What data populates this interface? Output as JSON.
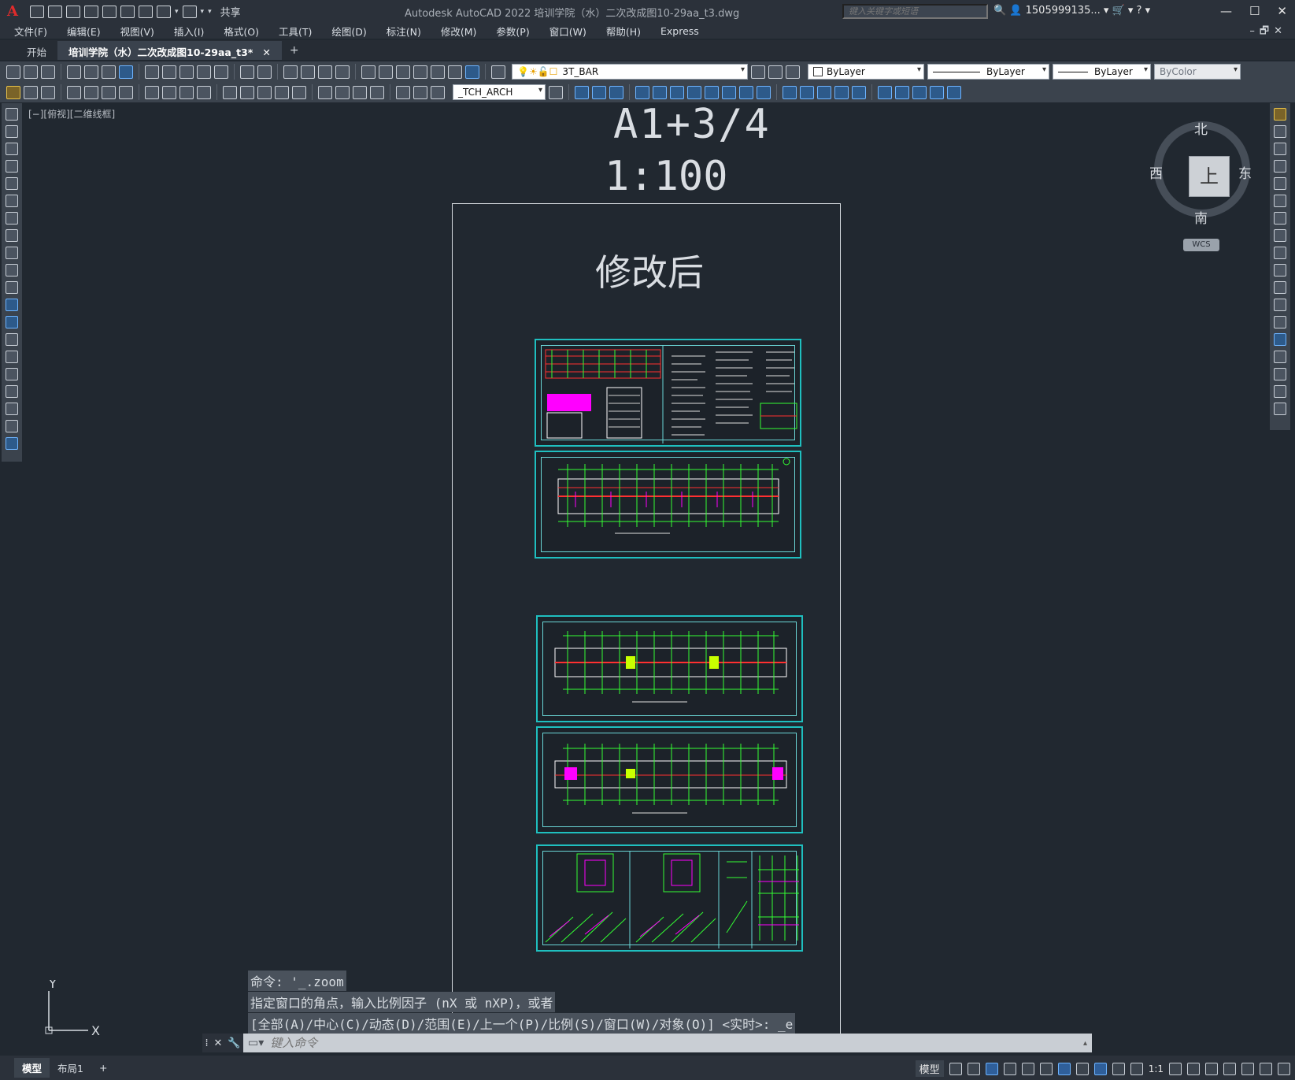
{
  "app": {
    "logo": "A",
    "title": "Autodesk AutoCAD 2022    培训学院（水）二次改成图10-29aa_t3.dwg",
    "share": "共享",
    "search_placeholder": "键入关键字或短语",
    "user": "1505999135...",
    "help": "?"
  },
  "window_controls": {
    "minimize": "—",
    "maximize": "☐",
    "close": "✕"
  },
  "menu": [
    "文件(F)",
    "编辑(E)",
    "视图(V)",
    "插入(I)",
    "格式(O)",
    "工具(T)",
    "绘图(D)",
    "标注(N)",
    "修改(M)",
    "参数(P)",
    "窗口(W)",
    "帮助(H)",
    "Express"
  ],
  "tabs": {
    "start": "开始",
    "active": "培训学院（水）二次改成图10-29aa_t3*",
    "close": "✕",
    "add": "+"
  },
  "toolbar": {
    "layer": "3T_BAR",
    "color": "ByLayer",
    "linetype": "ByLayer",
    "lineweight": "ByLayer",
    "plotstyle": "ByColor",
    "textstyle": "_TCH_ARCH"
  },
  "viewport": {
    "label": "[−][俯视][二维线框]"
  },
  "drawing": {
    "title1": "A1+3/4",
    "title2": "1:100",
    "title3": "修改后"
  },
  "viewcube": {
    "n": "北",
    "s": "南",
    "e": "东",
    "w": "西",
    "top": "上",
    "wcs": "WCS"
  },
  "ucs": {
    "x": "X",
    "y": "Y"
  },
  "command": {
    "history": [
      "命令: '_.zoom",
      "指定窗口的角点，输入比例因子 (nX 或 nXP)，或者",
      "[全部(A)/中心(C)/动态(D)/范围(E)/上一个(P)/比例(S)/窗口(W)/对象(O)] <实时>: _e"
    ],
    "placeholder": "键入命令"
  },
  "layouts": [
    "模型",
    "布局1"
  ],
  "layout_add": "+",
  "status": {
    "model": "模型",
    "scale": "1:1"
  }
}
